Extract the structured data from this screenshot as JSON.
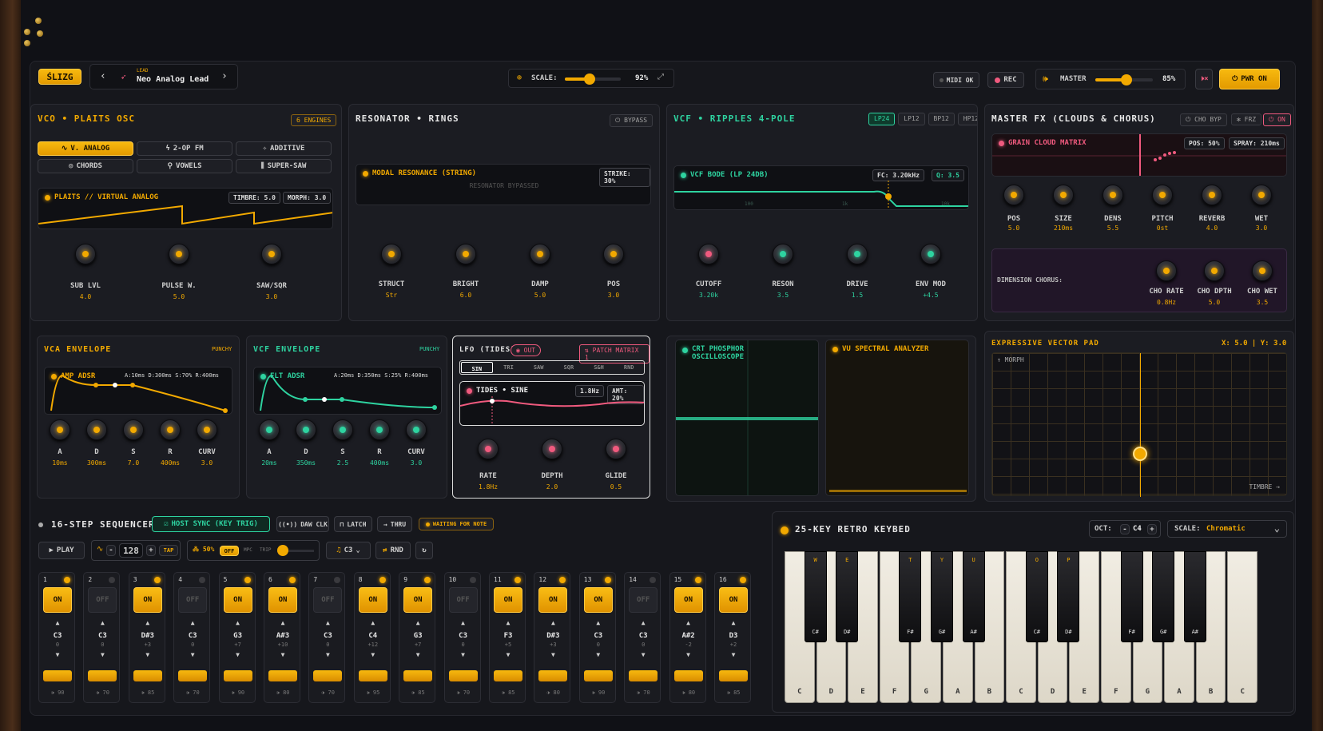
{
  "header": {
    "logo": "ŚLIZG",
    "patch_category": "LEAD",
    "patch_name": "Neo Analog Lead",
    "scale_label": "SCALE:",
    "scale_value": "92%",
    "midi": "MIDI OK",
    "rec": "REC",
    "master_label": "MASTER",
    "master_value": "85%",
    "power": "PWR ON"
  },
  "vco": {
    "title": "VCO • PLAITS OSC",
    "engines": "6 ENGINES",
    "modes": [
      "V. ANALOG",
      "2-OP FM",
      "ADDITIVE",
      "CHORDS",
      "VOWELS",
      "SUPER-SAW"
    ],
    "screen_title": "PLAITS // VIRTUAL ANALOG",
    "timbre": "TIMBRE: 5.0",
    "morph": "MORPH: 3.0",
    "knobs": [
      {
        "label": "SUB LVL",
        "value": "4.0"
      },
      {
        "label": "PULSE W.",
        "value": "5.0"
      },
      {
        "label": "SAW/SQR",
        "value": "3.0"
      }
    ]
  },
  "resonator": {
    "title": "RESONATOR • RINGS",
    "bypass": "BYPASS",
    "screen_title": "MODAL RESONANCE (STRING)",
    "strike": "STRIKE: 30%",
    "bypassed": "RESONATOR BYPASSED",
    "knobs": [
      {
        "label": "STRUCT",
        "value": "Str"
      },
      {
        "label": "BRIGHT",
        "value": "6.0"
      },
      {
        "label": "DAMP",
        "value": "5.0"
      },
      {
        "label": "POS",
        "value": "3.0"
      }
    ]
  },
  "vcf": {
    "title": "VCF • RIPPLES 4-POLE",
    "modes": [
      "LP24",
      "LP12",
      "BP12",
      "HP12"
    ],
    "screen_title": "VCF BODE (LP 24DB)",
    "fc": "FC: 3.20kHz",
    "q": "Q: 3.5",
    "grid_labels": [
      "100",
      "1k",
      "10k"
    ],
    "knobs": [
      {
        "label": "CUTOFF",
        "value": "3.20k"
      },
      {
        "label": "RESON",
        "value": "3.5"
      },
      {
        "label": "DRIVE",
        "value": "1.5"
      },
      {
        "label": "ENV MOD",
        "value": "+4.5"
      }
    ]
  },
  "fx": {
    "title": "MASTER FX (CLOUDS & CHORUS)",
    "cho_byp": "CHO BYP",
    "frz": "FRZ",
    "on": "ON",
    "screen_title": "GRAIN CLOUD MATRIX",
    "pos": "POS: 50%",
    "spray": "SPRAY: 210ms",
    "knobs": [
      {
        "label": "POS",
        "value": "5.0"
      },
      {
        "label": "SIZE",
        "value": "210ms"
      },
      {
        "label": "DENS",
        "value": "5.5"
      },
      {
        "label": "PITCH",
        "value": "0st"
      },
      {
        "label": "REVERB",
        "value": "4.0"
      },
      {
        "label": "WET",
        "value": "3.0"
      }
    ],
    "chorus_label": "DIMENSION CHORUS:",
    "chorus_knobs": [
      {
        "label": "CHO RATE",
        "value": "0.8Hz"
      },
      {
        "label": "CHO DPTH",
        "value": "5.0"
      },
      {
        "label": "CHO WET",
        "value": "3.5"
      }
    ]
  },
  "vca_env": {
    "title": "VCA ENVELOPE",
    "style": "PUNCHY",
    "screen_title": "AMP ADSR",
    "params": "A:10ms D:300ms S:70% R:400ms",
    "knobs": [
      {
        "label": "A",
        "value": "10ms"
      },
      {
        "label": "D",
        "value": "300ms"
      },
      {
        "label": "S",
        "value": "7.0"
      },
      {
        "label": "R",
        "value": "400ms"
      },
      {
        "label": "CURV",
        "value": "3.0"
      }
    ]
  },
  "vcf_env": {
    "title": "VCF ENVELOPE",
    "style": "PUNCHY",
    "screen_title": "FLT ADSR",
    "params": "A:20ms D:350ms S:25% R:400ms",
    "knobs": [
      {
        "label": "A",
        "value": "20ms"
      },
      {
        "label": "D",
        "value": "350ms"
      },
      {
        "label": "S",
        "value": "2.5"
      },
      {
        "label": "R",
        "value": "400ms"
      },
      {
        "label": "CURV",
        "value": "3.0"
      }
    ]
  },
  "lfo": {
    "title": "LFO (TIDES)",
    "out": "OUT",
    "patch": "PATCH MATRIX",
    "patch_count": "1",
    "waves": [
      "SIN",
      "TRI",
      "SAW",
      "SQR",
      "S&H",
      "RND"
    ],
    "screen_title": "TIDES • SINE",
    "rate_tag": "1.8Hz",
    "amt_tag": "AMT: 20%",
    "knobs": [
      {
        "label": "RATE",
        "value": "1.8Hz"
      },
      {
        "label": "DEPTH",
        "value": "2.0"
      },
      {
        "label": "GLIDE",
        "value": "0.5"
      }
    ]
  },
  "scope": {
    "title_line1": "CRT PHOSPHOR",
    "title_line2": "OSCILLOSCOPE"
  },
  "vu": {
    "title": "VU SPECTRAL ANALYZER"
  },
  "pad": {
    "title": "EXPRESSIVE VECTOR PAD",
    "xy": "X: 5.0 | Y: 3.0",
    "morph": "↑ MORPH",
    "timbre": "TIMBRE →",
    "x": 5.0,
    "y": 3.0
  },
  "seq": {
    "title": "16-STEP SEQUENCER",
    "host_sync": "HOST SYNC (KEY TRIG)",
    "daw": "DAW CLK",
    "latch": "LATCH",
    "thru": "THRU",
    "waiting": "WAITING FOR NOTE",
    "play": "PLAY",
    "bpm": "128",
    "tap": "TAP",
    "swing": "50%",
    "swing_off": "OFF",
    "mpc": "MPC",
    "trip": "TRIP",
    "root": "C3",
    "rnd": "RND",
    "steps": [
      {
        "n": "1",
        "on": true,
        "note": "C3",
        "tr": "0",
        "vel": "90"
      },
      {
        "n": "2",
        "on": false,
        "note": "C3",
        "tr": "0",
        "vel": "70"
      },
      {
        "n": "3",
        "on": true,
        "note": "D#3",
        "tr": "+3",
        "vel": "85"
      },
      {
        "n": "4",
        "on": false,
        "note": "C3",
        "tr": "0",
        "vel": "70"
      },
      {
        "n": "5",
        "on": true,
        "note": "G3",
        "tr": "+7",
        "vel": "90"
      },
      {
        "n": "6",
        "on": true,
        "note": "A#3",
        "tr": "+10",
        "vel": "80"
      },
      {
        "n": "7",
        "on": false,
        "note": "C3",
        "tr": "0",
        "vel": "70"
      },
      {
        "n": "8",
        "on": true,
        "note": "C4",
        "tr": "+12",
        "vel": "95"
      },
      {
        "n": "9",
        "on": true,
        "note": "G3",
        "tr": "+7",
        "vel": "85"
      },
      {
        "n": "10",
        "on": false,
        "note": "C3",
        "tr": "0",
        "vel": "70"
      },
      {
        "n": "11",
        "on": true,
        "note": "F3",
        "tr": "+5",
        "vel": "85"
      },
      {
        "n": "12",
        "on": true,
        "note": "D#3",
        "tr": "+3",
        "vel": "80"
      },
      {
        "n": "13",
        "on": true,
        "note": "C3",
        "tr": "0",
        "vel": "90"
      },
      {
        "n": "14",
        "on": false,
        "note": "C3",
        "tr": "0",
        "vel": "70"
      },
      {
        "n": "15",
        "on": true,
        "note": "A#2",
        "tr": "-2",
        "vel": "80"
      },
      {
        "n": "16",
        "on": true,
        "note": "D3",
        "tr": "+2",
        "vel": "85"
      }
    ],
    "on_label": "ON",
    "off_label": "OFF"
  },
  "keys": {
    "title": "25-KEY RETRO KEYBED",
    "oct_label": "OCT:",
    "oct": "C4",
    "scale_label": "SCALE:",
    "scale": "Chromatic",
    "white": [
      "C",
      "D",
      "E",
      "F",
      "G",
      "A",
      "B",
      "C",
      "D",
      "E",
      "F",
      "G",
      "A",
      "B",
      "C"
    ],
    "black": [
      {
        "top": "W",
        "bot": "C#"
      },
      {
        "top": "E",
        "bot": "D#"
      },
      {
        "top": "T",
        "bot": "F#"
      },
      {
        "top": "Y",
        "bot": "G#"
      },
      {
        "top": "U",
        "bot": "A#"
      },
      {
        "top": "O",
        "bot": "C#"
      },
      {
        "top": "P",
        "bot": "D#"
      },
      {
        "top": "",
        "bot": "F#"
      },
      {
        "top": "",
        "bot": "G#"
      },
      {
        "top": "",
        "bot": "A#"
      }
    ]
  }
}
